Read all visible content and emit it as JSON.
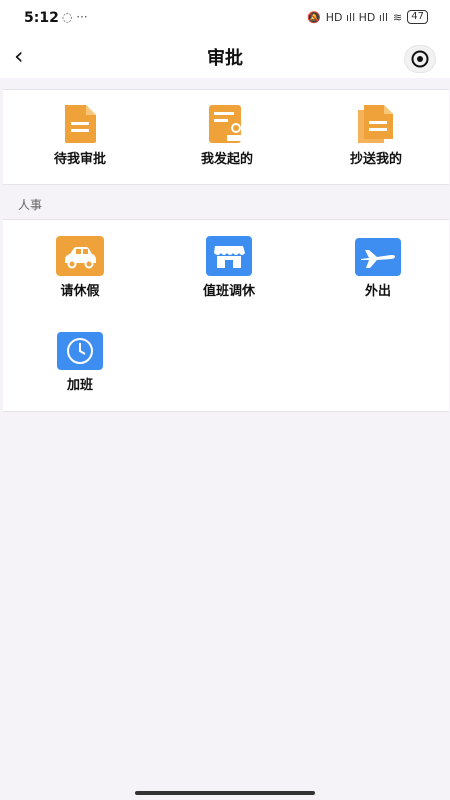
{
  "status_bar": {
    "time": "5:12",
    "notif_icons": "◌ ···",
    "signal_text": "HD ıll HD ıll",
    "battery": "47"
  },
  "nav": {
    "title": "审批"
  },
  "top_items": [
    {
      "label": "待我审批",
      "icon": "document-icon",
      "color": "#f0a23a"
    },
    {
      "label": "我发起的",
      "icon": "document-stamp-icon",
      "color": "#f0a23a"
    },
    {
      "label": "抄送我的",
      "icon": "documents-stack-icon",
      "color": "#f0a23a"
    }
  ],
  "hr": {
    "section_title": "人事",
    "items": [
      {
        "label": "请休假",
        "icon": "car-icon",
        "color": "#f0a23a"
      },
      {
        "label": "值班调休",
        "icon": "shop-icon",
        "color": "#3d8ef0"
      },
      {
        "label": "外出",
        "icon": "airplane-icon",
        "color": "#3d8ef0"
      },
      {
        "label": "加班",
        "icon": "clock-icon",
        "color": "#3d8ef0"
      }
    ]
  }
}
